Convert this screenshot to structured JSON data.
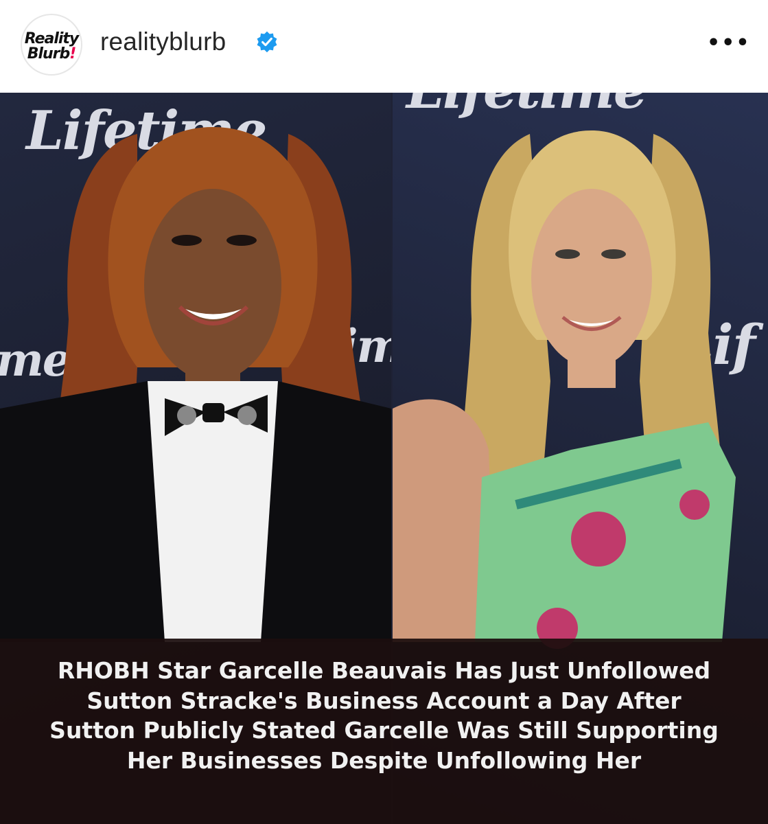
{
  "post": {
    "username": "realityblurb",
    "avatar_text_line1": "Reality",
    "avatar_text_line2": "Blurb",
    "avatar_text_bang": "!",
    "verified_icon": "verified-badge-icon",
    "more_icon": "more-options-icon",
    "more_label": "•••"
  },
  "image": {
    "watermarks": {
      "left_top": "Lifetime",
      "left_mid": "me",
      "center_mid": "time",
      "right_top": "Lifetime",
      "right_mid": "Lif"
    },
    "caption": "RHOBH Star Garcelle Beauvais Has Just Unfollowed Sutton Stracke's Business Account a Day After Sutton Publicly Stated Garcelle Was Still Supporting Her Businesses Despite Unfollowing Her"
  },
  "colors": {
    "verified": "#1d9bf0",
    "brand_accent": "#e8004c",
    "caption_band": "#1c0e0e"
  }
}
